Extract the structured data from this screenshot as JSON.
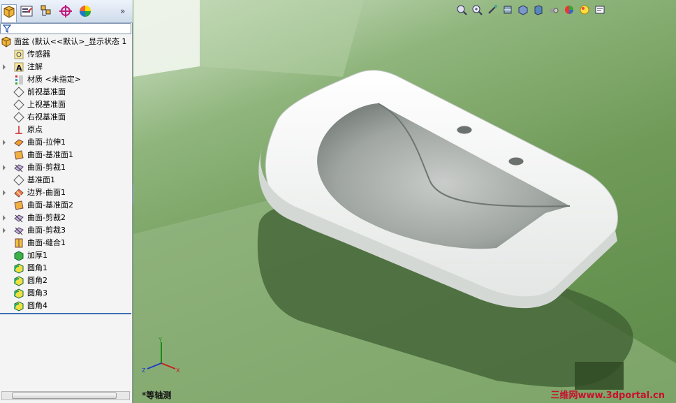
{
  "feature_tree": {
    "root": "面盆 (默认<<默认>_显示状态 1",
    "items": [
      {
        "label": "传感器",
        "icon": "sensor-icon",
        "expandable": false
      },
      {
        "label": "注解",
        "icon": "annotation-icon",
        "expandable": true
      },
      {
        "label": "材质 <未指定>",
        "icon": "material-icon",
        "expandable": false
      },
      {
        "label": "前视基准面",
        "icon": "plane-icon",
        "expandable": false
      },
      {
        "label": "上视基准面",
        "icon": "plane-icon",
        "expandable": false
      },
      {
        "label": "右视基准面",
        "icon": "plane-icon",
        "expandable": false
      },
      {
        "label": "原点",
        "icon": "origin-icon",
        "expandable": false
      },
      {
        "label": "曲面-拉伸1",
        "icon": "surface-extrude-icon",
        "expandable": true
      },
      {
        "label": "曲面-基准面1",
        "icon": "planar-surface-icon",
        "expandable": false
      },
      {
        "label": "曲面-剪裁1",
        "icon": "surface-trim-icon",
        "expandable": true
      },
      {
        "label": "基准面1",
        "icon": "plane-icon",
        "expandable": false
      },
      {
        "label": "边界-曲面1",
        "icon": "boundary-surface-icon",
        "expandable": true
      },
      {
        "label": "曲面-基准面2",
        "icon": "planar-surface-icon",
        "expandable": false
      },
      {
        "label": "曲面-剪裁2",
        "icon": "surface-trim-icon",
        "expandable": true
      },
      {
        "label": "曲面-剪裁3",
        "icon": "surface-trim-icon",
        "expandable": true
      },
      {
        "label": "曲面-缝合1",
        "icon": "surface-knit-icon",
        "expandable": false
      },
      {
        "label": "加厚1",
        "icon": "thicken-icon",
        "expandable": false
      },
      {
        "label": "圆角1",
        "icon": "fillet-icon",
        "expandable": false
      },
      {
        "label": "圆角2",
        "icon": "fillet-icon",
        "expandable": false
      },
      {
        "label": "圆角3",
        "icon": "fillet-icon",
        "expandable": false
      },
      {
        "label": "圆角4",
        "icon": "fillet-icon",
        "expandable": false
      }
    ]
  },
  "tabs": [
    "feature-manager-tab",
    "property-manager-tab",
    "configuration-manager-tab",
    "dimxpert-tab",
    "display-manager-tab"
  ],
  "heads_up_toolbar": [
    "zoom-to-fit-icon",
    "zoom-to-area-icon",
    "previous-view-icon",
    "section-view-icon",
    "view-orientation-icon",
    "display-style-icon",
    "hide-show-icon",
    "edit-appearance-icon",
    "apply-scene-icon",
    "view-settings-icon"
  ],
  "view_name": "*等轴测",
  "watermark": "三维网www.3dportal.cn",
  "triad": {
    "x": "X",
    "y": "Y",
    "z": "Z"
  },
  "colors": {
    "background_green": "#6f9a58",
    "tree_bg": "#f4f4f4",
    "accent_blue": "#3d6fb5",
    "watermark_red": "#c8102e"
  }
}
